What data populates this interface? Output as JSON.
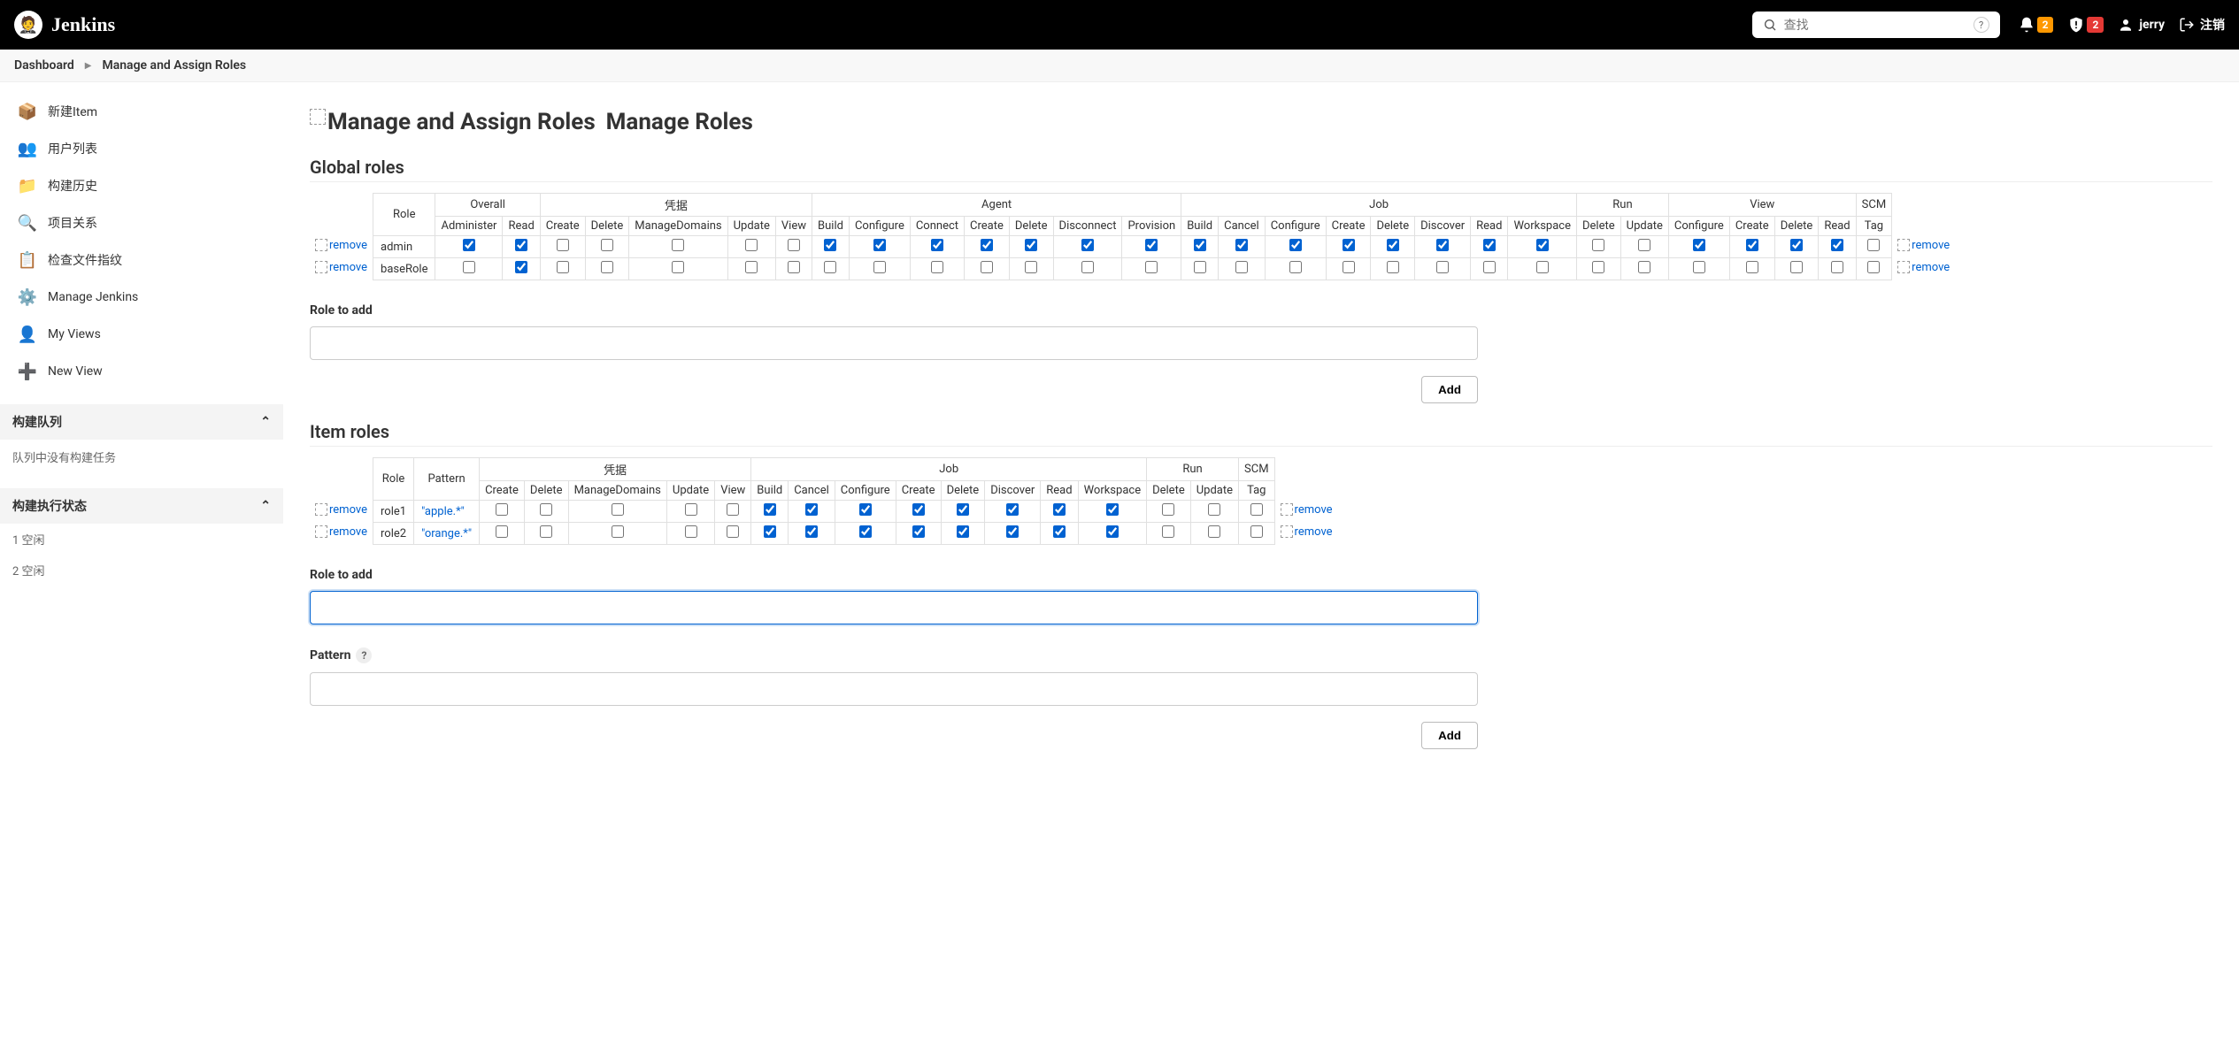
{
  "header": {
    "brand": "Jenkins",
    "search_placeholder": "查找",
    "notif_count": "2",
    "alert_count": "2",
    "username": "jerry",
    "logout": "注销"
  },
  "breadcrumb": {
    "dashboard": "Dashboard",
    "current": "Manage and Assign Roles"
  },
  "sidebar": {
    "items": [
      {
        "icon": "📦",
        "label": "新建Item"
      },
      {
        "icon": "👥",
        "label": "用户列表"
      },
      {
        "icon": "📁",
        "label": "构建历史"
      },
      {
        "icon": "🔍",
        "label": "项目关系"
      },
      {
        "icon": "📋",
        "label": "检查文件指纹"
      },
      {
        "icon": "⚙️",
        "label": "Manage Jenkins"
      },
      {
        "icon": "👤",
        "label": "My Views"
      },
      {
        "icon": "➕",
        "label": "New View"
      }
    ],
    "queue_title": "构建队列",
    "queue_empty": "队列中没有构建任务",
    "executor_title": "构建执行状态",
    "idle1": "1 空闲",
    "idle2": "2 空闲"
  },
  "page": {
    "img_alt": "Manage and Assign Roles",
    "title": "Manage Roles",
    "global_section": "Global roles",
    "item_section": "Item roles",
    "role_label": "Role",
    "pattern_label": "Pattern",
    "role_to_add": "Role to add",
    "pattern_field": "Pattern",
    "add_btn": "Add",
    "remove_text": "remove"
  },
  "global_groups": [
    {
      "name": "Overall",
      "cols": [
        "Administer",
        "Read"
      ]
    },
    {
      "name": "凭据",
      "cols": [
        "Create",
        "Delete",
        "ManageDomains",
        "Update",
        "View"
      ]
    },
    {
      "name": "Agent",
      "cols": [
        "Build",
        "Configure",
        "Connect",
        "Create",
        "Delete",
        "Disconnect",
        "Provision"
      ]
    },
    {
      "name": "Job",
      "cols": [
        "Build",
        "Cancel",
        "Configure",
        "Create",
        "Delete",
        "Discover",
        "Read",
        "Workspace"
      ]
    },
    {
      "name": "Run",
      "cols": [
        "Delete",
        "Update"
      ]
    },
    {
      "name": "View",
      "cols": [
        "Configure",
        "Create",
        "Delete",
        "Read"
      ]
    },
    {
      "name": "SCM",
      "cols": [
        "Tag"
      ]
    }
  ],
  "global_rows": [
    {
      "name": "admin",
      "checks": [
        true,
        true,
        false,
        false,
        false,
        false,
        false,
        true,
        true,
        true,
        true,
        true,
        true,
        true,
        true,
        true,
        true,
        true,
        true,
        true,
        true,
        true,
        false,
        false,
        true,
        true,
        true,
        true,
        false
      ]
    },
    {
      "name": "baseRole",
      "checks": [
        false,
        true,
        false,
        false,
        false,
        false,
        false,
        false,
        false,
        false,
        false,
        false,
        false,
        false,
        false,
        false,
        false,
        false,
        false,
        false,
        false,
        false,
        false,
        false,
        false,
        false,
        false,
        false,
        false
      ]
    }
  ],
  "item_groups": [
    {
      "name": "凭据",
      "cols": [
        "Create",
        "Delete",
        "ManageDomains",
        "Update",
        "View"
      ]
    },
    {
      "name": "Job",
      "cols": [
        "Build",
        "Cancel",
        "Configure",
        "Create",
        "Delete",
        "Discover",
        "Read",
        "Workspace"
      ]
    },
    {
      "name": "Run",
      "cols": [
        "Delete",
        "Update"
      ]
    },
    {
      "name": "SCM",
      "cols": [
        "Tag"
      ]
    }
  ],
  "item_rows": [
    {
      "name": "role1",
      "pattern": "\"apple.*\"",
      "checks": [
        false,
        false,
        false,
        false,
        false,
        true,
        true,
        true,
        true,
        true,
        true,
        true,
        true,
        false,
        false,
        false
      ]
    },
    {
      "name": "role2",
      "pattern": "\"orange.*\"",
      "checks": [
        false,
        false,
        false,
        false,
        false,
        true,
        true,
        true,
        true,
        true,
        true,
        true,
        true,
        false,
        false,
        false
      ]
    }
  ]
}
